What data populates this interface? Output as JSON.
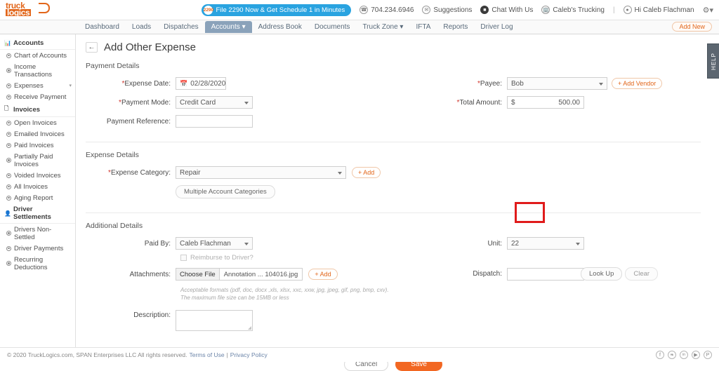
{
  "brand": {
    "logo_line1": "truck",
    "logo_line2": "logics",
    "accent": "#e2661a"
  },
  "topbar": {
    "promo": {
      "badge": "2290",
      "label": "File 2290 Now & Get Schedule 1 in Minutes"
    },
    "links": [
      {
        "icon": "phone-icon",
        "label": "704.234.6946"
      },
      {
        "icon": "envelope-icon",
        "label": "Suggestions"
      },
      {
        "icon": "chat-icon",
        "label": "Chat With Us"
      },
      {
        "icon": "building-icon",
        "label": "Caleb's Trucking"
      },
      {
        "icon": "user-icon",
        "label": "Hi Caleb Flachman"
      }
    ],
    "separator": "|",
    "gear": "⚙",
    "gear_caret": "▾"
  },
  "mainnav": {
    "items": [
      {
        "label": "Dashboard",
        "active": false,
        "caret": false
      },
      {
        "label": "Loads",
        "active": false,
        "caret": false
      },
      {
        "label": "Dispatches",
        "active": false,
        "caret": false
      },
      {
        "label": "Accounts",
        "active": true,
        "caret": true
      },
      {
        "label": "Address Book",
        "active": false,
        "caret": false
      },
      {
        "label": "Documents",
        "active": false,
        "caret": false
      },
      {
        "label": "Truck Zone",
        "active": false,
        "caret": true
      },
      {
        "label": "IFTA",
        "active": false,
        "caret": false
      },
      {
        "label": "Reports",
        "active": false,
        "caret": false
      },
      {
        "label": "Driver Log",
        "active": false,
        "caret": false
      }
    ],
    "add_new": "Add New"
  },
  "sidebar": {
    "groups": [
      {
        "label": "Accounts",
        "icon": "bar-chart-icon",
        "items": [
          {
            "label": "Chart of Accounts",
            "caret": false
          },
          {
            "label": "Income Transactions",
            "caret": false
          },
          {
            "label": "Expenses",
            "caret": true
          },
          {
            "label": "Receive Payment",
            "caret": false
          }
        ]
      },
      {
        "label": "Invoices",
        "icon": "document-icon",
        "items": [
          {
            "label": "Open Invoices",
            "caret": false
          },
          {
            "label": "Emailed Invoices",
            "caret": false
          },
          {
            "label": "Paid Invoices",
            "caret": false
          },
          {
            "label": "Partially Paid Invoices",
            "caret": false
          },
          {
            "label": "Voided Invoices",
            "caret": false
          },
          {
            "label": "All Invoices",
            "caret": false
          },
          {
            "label": "Aging Report",
            "caret": false
          }
        ]
      },
      {
        "label": "Driver Settlements",
        "icon": "driver-icon",
        "items": [
          {
            "label": "Drivers Non-Settled",
            "caret": false
          },
          {
            "label": "Driver Payments",
            "caret": false
          },
          {
            "label": "Recurring Deductions",
            "caret": false
          }
        ]
      }
    ]
  },
  "page": {
    "back_icon": "←",
    "title": "Add Other Expense"
  },
  "payment_details": {
    "section_title": "Payment Details",
    "expense_date_label": "Expense Date:",
    "expense_date_value": "02/28/2020",
    "payment_mode_label": "Payment Mode:",
    "payment_mode_value": "Credit Card",
    "payment_reference_label": "Payment Reference:",
    "payment_reference_value": "",
    "payee_label": "Payee:",
    "payee_value": "Bob",
    "add_vendor_label": "+ Add Vendor",
    "total_amount_label": "Total Amount:",
    "currency_symbol": "$",
    "total_amount_value": "500.00"
  },
  "expense_details": {
    "section_title": "Expense Details",
    "expense_category_label": "Expense Category:",
    "expense_category_value": "Repair",
    "add_label": "+ Add",
    "multiple_categories_label": "Multiple Account Categories"
  },
  "additional_details": {
    "section_title": "Additional Details",
    "paid_by_label": "Paid By:",
    "paid_by_value": "Caleb Flachman",
    "reimburse_label": "Reimburse to Driver?",
    "attachments_label": "Attachments:",
    "choose_file_label": "Choose File",
    "file_name": "Annotation ... 104016.jpg",
    "add_label": "+ Add",
    "hint": "Acceptable formats (pdf, doc, docx ,xls, xlsx, xxc, xxw, jpg, jpeg, gif, png, bmp, cxv). The maximum file size can be 15MB or less",
    "description_label": "Description:",
    "description_value": "",
    "unit_label": "Unit:",
    "unit_value": "22",
    "dispatch_label": "Dispatch:",
    "dispatch_value": "",
    "look_up_label": "Look Up",
    "clear_label": "Clear",
    "highlight_color": "#e01b1b"
  },
  "actions": {
    "cancel_label": "Cancel",
    "save_label": "Save"
  },
  "help_tab": {
    "label": "HELP"
  },
  "footer": {
    "copyright": "© 2020 TruckLogics.com, SPAN Enterprises LLC All rights reserved.",
    "terms": "Terms of Use",
    "divider": "|",
    "privacy": "Privacy Policy",
    "socials": [
      {
        "name": "facebook-icon",
        "glyph": "f"
      },
      {
        "name": "twitter-icon",
        "glyph": "❧"
      },
      {
        "name": "linkedin-icon",
        "glyph": "in"
      },
      {
        "name": "youtube-icon",
        "glyph": "▶"
      },
      {
        "name": "pinterest-icon",
        "glyph": "P"
      }
    ]
  }
}
